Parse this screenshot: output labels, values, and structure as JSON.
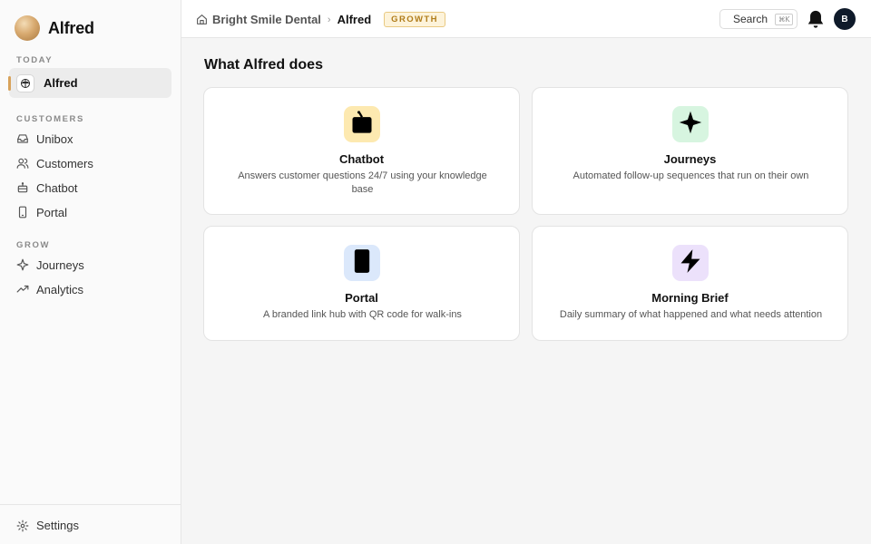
{
  "brand": {
    "name": "Alfred"
  },
  "sidebar": {
    "sections": [
      {
        "label": "TODAY"
      },
      {
        "label": "CUSTOMERS"
      },
      {
        "label": "GROW"
      }
    ],
    "active_item": {
      "label": "Alfred",
      "icon": "gift-icon"
    },
    "customers_items": [
      {
        "label": "Unibox",
        "icon": "inbox-icon"
      },
      {
        "label": "Customers",
        "icon": "users-icon"
      },
      {
        "label": "Chatbot",
        "icon": "bot-icon"
      },
      {
        "label": "Portal",
        "icon": "phone-icon"
      }
    ],
    "grow_items": [
      {
        "label": "Journeys",
        "icon": "sparkle-icon"
      },
      {
        "label": "Analytics",
        "icon": "trend-icon"
      }
    ],
    "settings": {
      "label": "Settings",
      "icon": "gear-icon"
    }
  },
  "header": {
    "breadcrumb": {
      "business": "Bright Smile Dental",
      "separator": "›",
      "current": "Alfred"
    },
    "plan_badge": "GROWTH",
    "search": {
      "label": "Search",
      "shortcut": "⌘K"
    },
    "avatar_initial": "B"
  },
  "main": {
    "title": "What Alfred does",
    "cards": [
      {
        "title": "Chatbot",
        "description": "Answers customer questions 24/7 using your knowledge base",
        "icon": "tv-icon",
        "icon_bg": "#fde9b0"
      },
      {
        "title": "Journeys",
        "description": "Automated follow-up sequences that run on their own",
        "icon": "sparkle-icon",
        "icon_bg": "#d7f5e0"
      },
      {
        "title": "Portal",
        "description": "A branded link hub with QR code for walk-ins",
        "icon": "phone-icon",
        "icon_bg": "#dbe8fb"
      },
      {
        "title": "Morning Brief",
        "description": "Daily summary of what happened and what needs attention",
        "icon": "lightning-icon",
        "icon_bg": "#ece1fb"
      }
    ]
  },
  "colors": {
    "accent": "#d8a25a",
    "badge_text": "#b07c1a",
    "avatar_bg": "#0f1a2a"
  }
}
